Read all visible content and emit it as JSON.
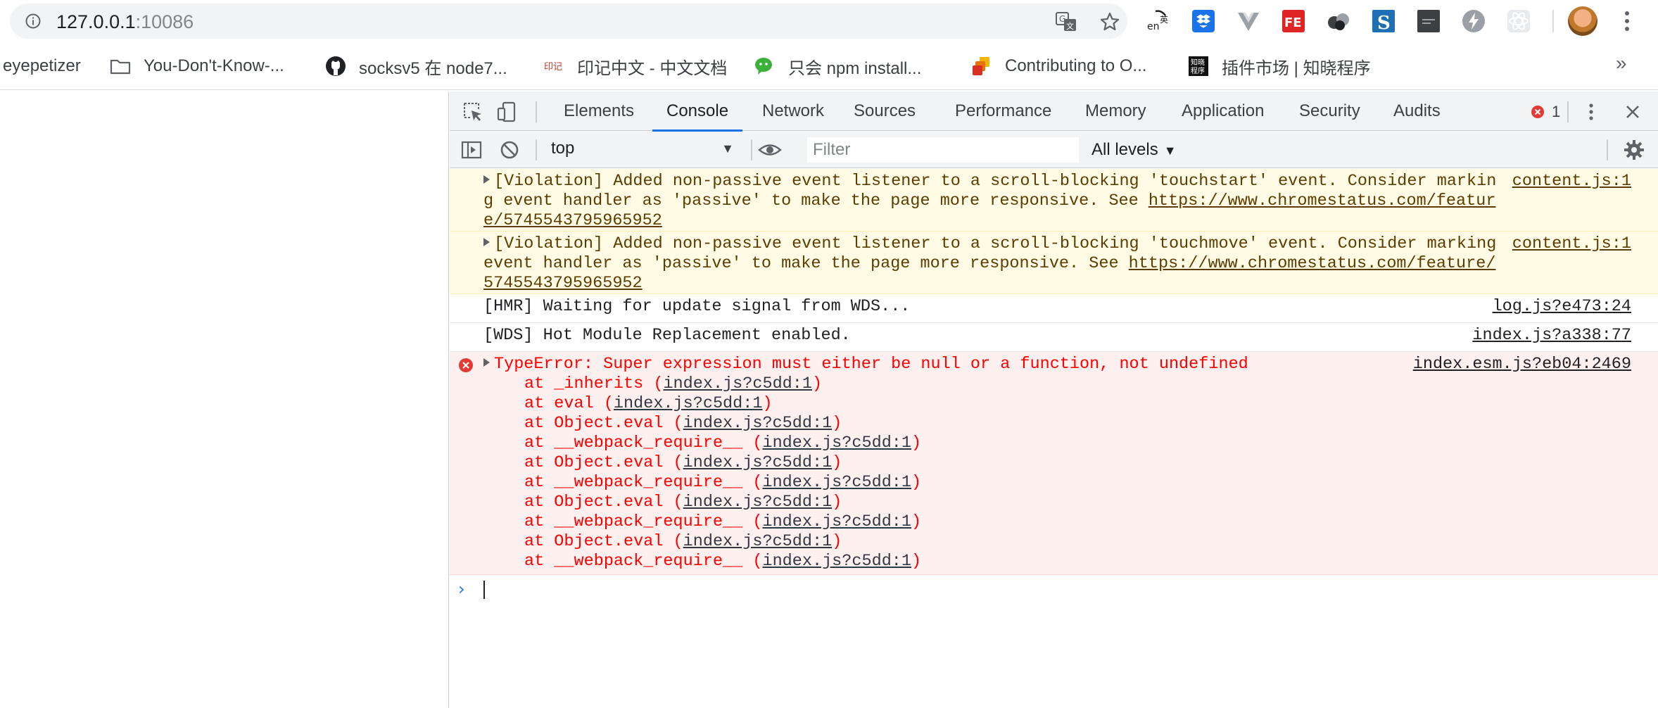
{
  "browser": {
    "url_host": "127.0.0.1",
    "url_port": ":10086",
    "extensions": [
      "en-translate-icon",
      "dropbox-icon",
      "vue-devtools-icon",
      "fe-helper-icon",
      "dots-icon",
      "s-icon",
      "dark-square-icon",
      "lightning-icon",
      "react-devtools-icon"
    ]
  },
  "bookmarks": [
    {
      "label": "eyepetizer"
    },
    {
      "label": "You-Don't-Know-..."
    },
    {
      "label": "socksv5 在 node7..."
    },
    {
      "label": "印记中文 - 中文文档"
    },
    {
      "label": "只会 npm install..."
    },
    {
      "label": "Contributing to O..."
    },
    {
      "label": "插件市场 | 知晓程序"
    }
  ],
  "bookmarks_overflow": "»",
  "devtools": {
    "tabs": [
      "Elements",
      "Console",
      "Network",
      "Sources",
      "Performance",
      "Memory",
      "Application",
      "Security",
      "Audits"
    ],
    "active_tab": "Console",
    "error_count": "1",
    "context": "top",
    "filter_placeholder": "Filter",
    "levels": "All levels"
  },
  "console": {
    "warn1": {
      "text_a": "[Violation] Added non-passive event listener to a scroll-blocking 'touchstart' event. Consider marking event handler as 'passive' to make the page more responsive. See ",
      "link": "https://www.chromestatus.com/feature/5745543795965952",
      "source": "content.js:1"
    },
    "warn2": {
      "text_a": "[Violation] Added non-passive event listener to a scroll-blocking 'touchmove' event. Consider marking event handler as 'passive' to make the page more responsive. See ",
      "link": "https://www.chromestatus.com/feature/5745543795965952",
      "source": "content.js:1"
    },
    "log1": {
      "text": "[HMR] Waiting for update signal from WDS...",
      "source": "log.js?e473:24"
    },
    "log2": {
      "text": "[WDS] Hot Module Replacement enabled.",
      "source": "index.js?a338:77"
    },
    "error": {
      "text": "TypeError: Super expression must either be null or a function, not undefined",
      "source": "index.esm.js?eb04:2469",
      "stack": [
        {
          "fn": "at _inherits (",
          "file": "index.js?c5dd:1"
        },
        {
          "fn": "at eval (",
          "file": "index.js?c5dd:1"
        },
        {
          "fn": "at Object.eval (",
          "file": "index.js?c5dd:1"
        },
        {
          "fn": "at __webpack_require__ (",
          "file": "index.js?c5dd:1"
        },
        {
          "fn": "at Object.eval (",
          "file": "index.js?c5dd:1"
        },
        {
          "fn": "at __webpack_require__ (",
          "file": "index.js?c5dd:1"
        },
        {
          "fn": "at Object.eval (",
          "file": "index.js?c5dd:1"
        },
        {
          "fn": "at __webpack_require__ (",
          "file": "index.js?c5dd:1"
        },
        {
          "fn": "at Object.eval (",
          "file": "index.js?c5dd:1"
        },
        {
          "fn": "at __webpack_require__ (",
          "file": "index.js?c5dd:1"
        }
      ]
    },
    "prompt_symbol": "›"
  }
}
